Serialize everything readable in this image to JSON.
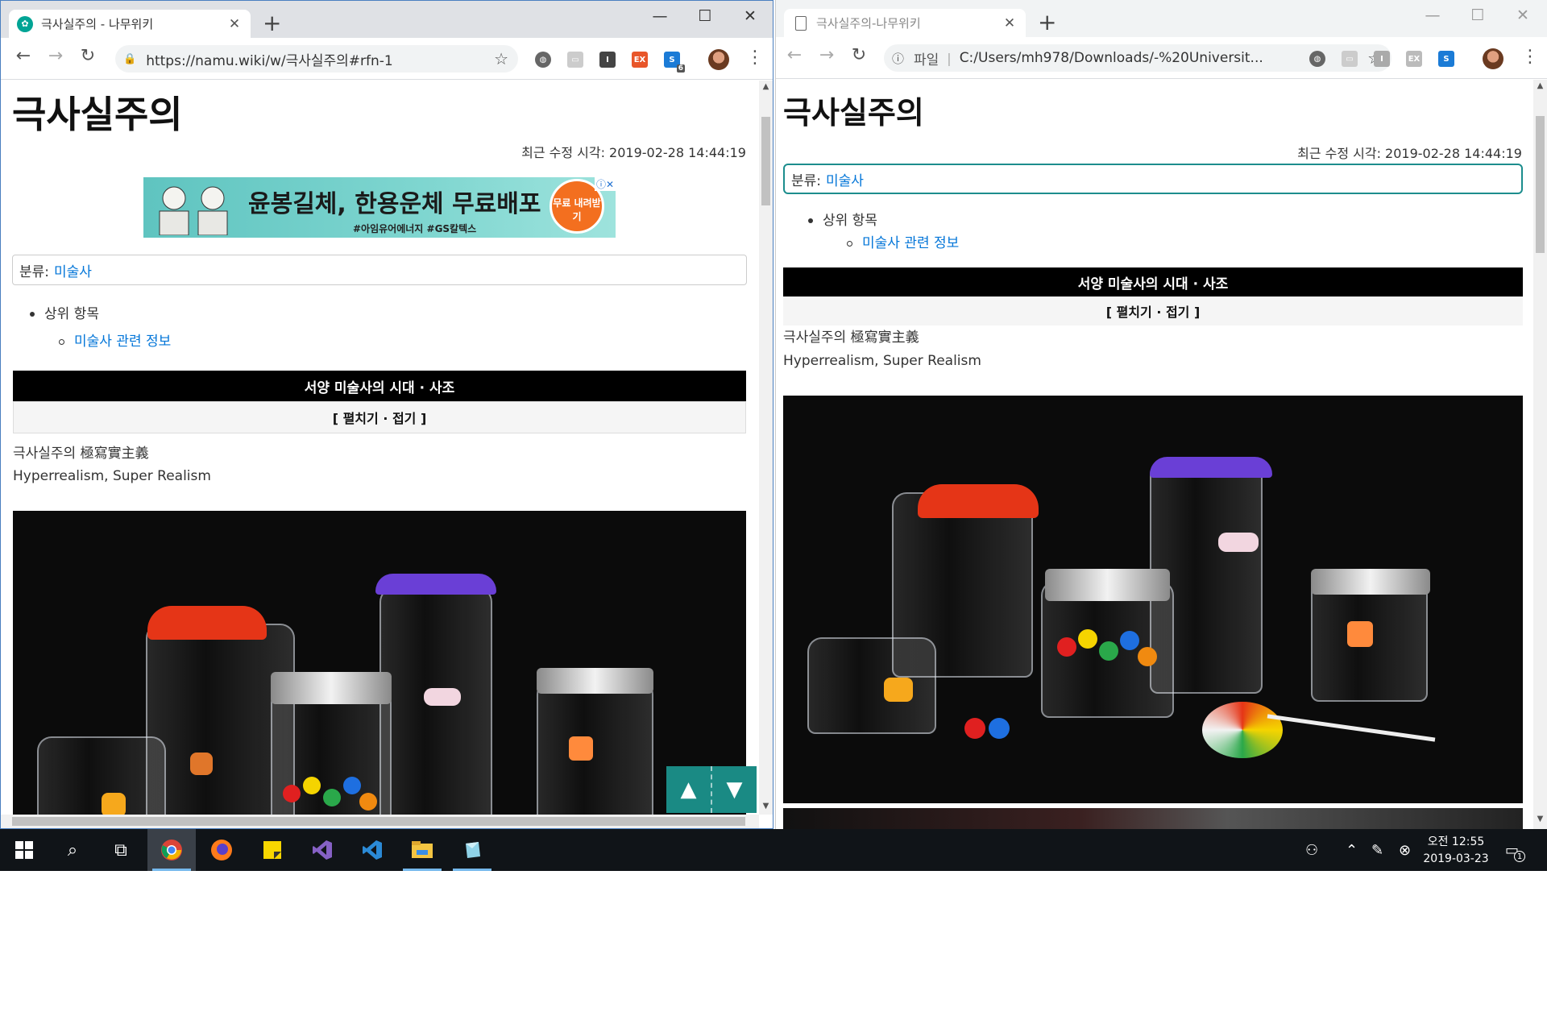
{
  "left_window": {
    "tab_title": "극사실주의 - 나무위키",
    "url": "https://namu.wiki/w/극사실주의#rfn-1",
    "page": {
      "title": "극사실주의",
      "last_modified": "최근 수정 시각: 2019-02-28 14:44:19",
      "ad": {
        "headline": "윤봉길체, 한용운체 무료배포",
        "sub": "#아임유어에너지 #GS칼텍스",
        "badge": "무료 내려받기"
      },
      "category_label": "분류:",
      "category_link": "미술사",
      "parent_label": "상위 항목",
      "parent_link": "미술사 관련 정보",
      "navbox_title": "서양 미술사의 시대 · 사조",
      "navbox_toggle": "[ 펼치기 · 접기 ]",
      "intro_line1": "극사실주의 極寫實主義",
      "intro_line2": "Hyperrealism, Super Realism"
    }
  },
  "right_window": {
    "tab_title": "극사실주의-나무위키",
    "url_prefix": "파일",
    "url": "C:/Users/mh978/Downloads/-%20Universit...",
    "page": {
      "title": "극사실주의",
      "last_modified": "최근 수정 시각: 2019-02-28 14:44:19",
      "category_label": "분류:",
      "category_link": "미술사",
      "parent_label": "상위 항목",
      "parent_link": "미술사 관련 정보",
      "navbox_title": "서양 미술사의 시대 · 사조",
      "navbox_toggle": "[ 펼치기 · 접기 ]",
      "intro_line1": "극사실주의 極寫實主義",
      "intro_line2": "Hyperrealism, Super Realism"
    }
  },
  "taskbar": {
    "time": "오전 12:55",
    "date": "2019-03-23",
    "notification_count": "1"
  },
  "extensions": {
    "skype_badge": "6"
  },
  "icons": {
    "back": "arrow-left-icon",
    "forward": "arrow-right-icon",
    "reload": "reload-icon",
    "star": "star-icon",
    "lock": "lock-icon",
    "info": "info-icon",
    "menu": "kebab-menu-icon"
  },
  "colors": {
    "accent_teal": "#1a8a84",
    "link_blue": "#0275d8",
    "navbox_black": "#000000"
  }
}
